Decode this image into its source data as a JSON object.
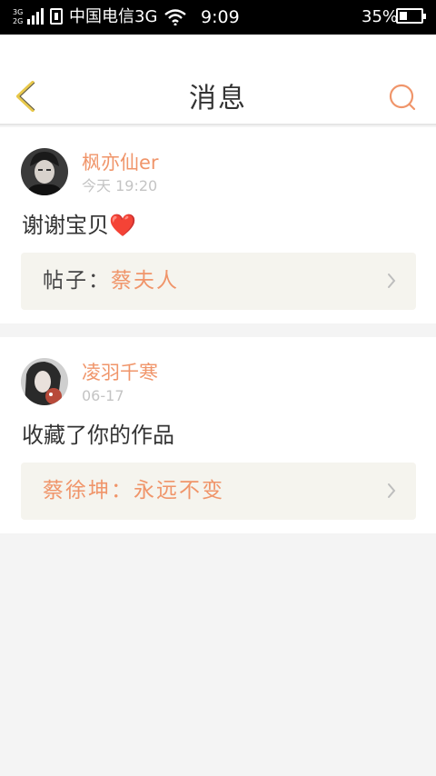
{
  "status_bar": {
    "network_top": "3G",
    "network_bottom": "2G",
    "carrier": "中国电信3G",
    "time": "9:09",
    "battery_percent_text": "35%",
    "battery_level": 0.35,
    "icons": [
      "signal-icon",
      "sim-icon",
      "wifi-icon",
      "battery-icon"
    ]
  },
  "header": {
    "title": "消息",
    "back_icon": "chevron-left-icon",
    "search_icon": "search-icon",
    "accent_color": "#f0956a",
    "back_icon_color": "#e8c84a"
  },
  "messages": [
    {
      "user": "枫亦仙er",
      "time": "今天 19:20",
      "text": "谢谢宝贝",
      "emoji": "❤️",
      "ref_label": "帖子：",
      "ref_value": "蔡夫人"
    },
    {
      "user": "凌羽千寒",
      "time": "06-17",
      "text": "收藏了你的作品",
      "emoji": "",
      "ref_label": "",
      "ref_value": "蔡徐坤：永远不变"
    }
  ]
}
